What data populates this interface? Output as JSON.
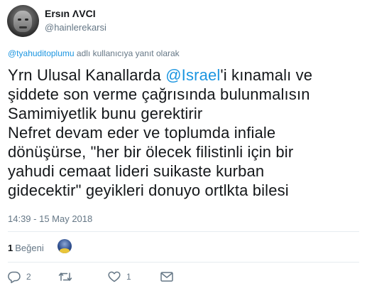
{
  "user": {
    "display_name": "Ersın ΛVCI",
    "screen_name": "@hainlerekarsi"
  },
  "reply_context": {
    "mention": "@tyahuditoplumu",
    "suffix": " adlı kullanıcıya yanıt olarak"
  },
  "tweet": {
    "text_before": "Yrn Ulusal Kanallarda ",
    "mention": "@Israel",
    "text_after": "'i kınamalı ve\nşiddete son verme çağrısında bulunmalısın\nSamimiyetlik bunu gerektirir\nNefret devam eder ve toplumda infiale\ndönüşürse, \"her bir ölecek filistinli için bir\nyahudi cemaat lideri suikaste kurban\ngidecektir\" geyikleri donuyo ortlkta bilesi",
    "timestamp": "14:39 - 15 May 2018"
  },
  "stats": {
    "likes_count": "1",
    "likes_label": "Beğeni"
  },
  "actions": {
    "reply_count": "2",
    "retweet_count": "",
    "like_count": "1"
  },
  "icons": {
    "reply": "reply-icon",
    "retweet": "retweet-icon",
    "like": "heart-icon",
    "dm": "envelope-icon"
  },
  "colors": {
    "link": "#1b95e0",
    "muted": "#657786",
    "text": "#14171a",
    "divider": "#e6ecf0"
  }
}
